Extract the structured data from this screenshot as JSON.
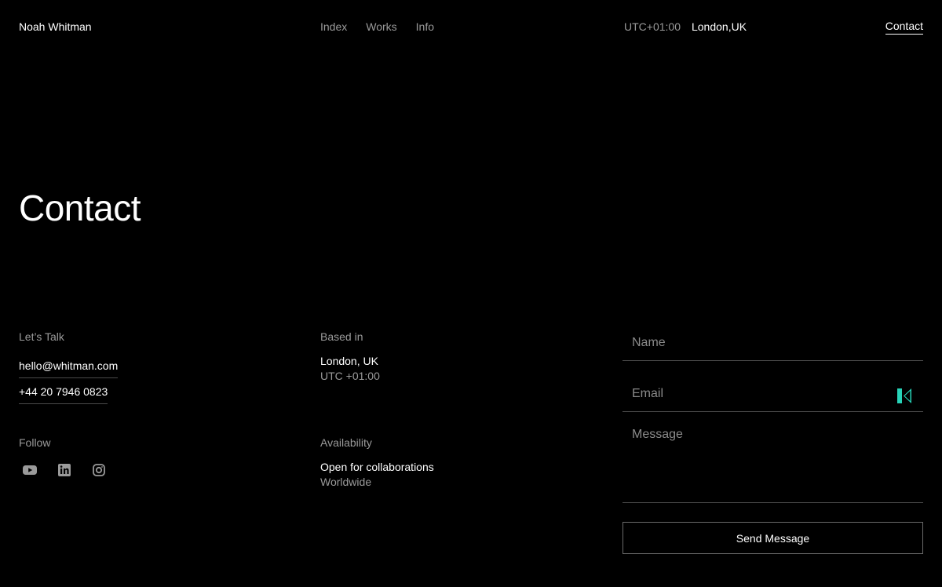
{
  "header": {
    "brand": "Noah Whitman",
    "nav": [
      "Index",
      "Works",
      "Info"
    ],
    "timezone": "UTC+01:00",
    "city": "London,UK",
    "contact_label": "Contact"
  },
  "page_title": "Contact",
  "lets_talk": {
    "label": "Let’s Talk",
    "email": "hello@whitman.com",
    "phone": "+44 20 7946 0823"
  },
  "follow": {
    "label": "Follow",
    "icons": [
      "youtube-icon",
      "linkedin-icon",
      "instagram-icon"
    ]
  },
  "based_in": {
    "label": "Based in",
    "city": "London, UK",
    "utc": "UTC +01:00"
  },
  "availability": {
    "label": "Availability",
    "status": "Open for collaborations",
    "scope": "Worldwide"
  },
  "form": {
    "name_placeholder": "Name",
    "email_placeholder": "Email",
    "message_placeholder": "Message",
    "submit_label": "Send Message"
  },
  "colors": {
    "background": "#000000",
    "text": "#ffffff",
    "muted": "#9a9a9a",
    "accent": "#27d3b8"
  }
}
